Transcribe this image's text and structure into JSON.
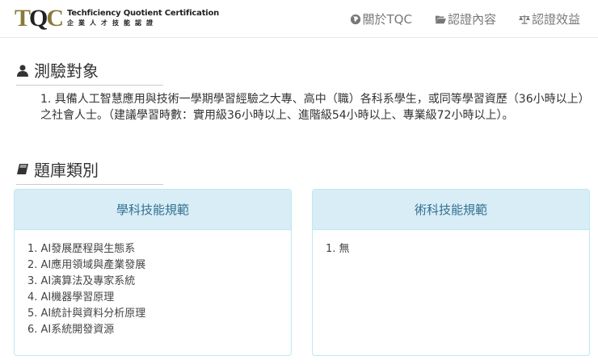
{
  "header": {
    "logo_mark": "TQC",
    "logo_en": "Techficiency Quotient Certification",
    "logo_zh": "企業人才技能認證",
    "nav": [
      {
        "label": "關於TQC",
        "icon": "globe-icon"
      },
      {
        "label": "認證內容",
        "icon": "folder-open-icon"
      },
      {
        "label": "認證效益",
        "icon": "balance-scale-icon"
      }
    ]
  },
  "section_target": {
    "title": "測驗對象",
    "items": [
      "1. 具備人工智慧應用與技術一學期學習經驗之大專、高中（職）各科系學生，或同等學習資歷（36小時以上）之社會人士。（建議學習時數：實用級36小時以上、進階級54小時以上、專業級72小時以上）。"
    ]
  },
  "section_bank": {
    "title": "題庫類別"
  },
  "panels": [
    {
      "title": "學科技能規範",
      "items": [
        "1. AI發展歷程與生態系",
        "2. AI應用領域與產業發展",
        "3. AI演算法及專家系統",
        "4. AI機器學習原理",
        "5. AI統計與資料分析原理",
        "6. AI系統開發資源"
      ]
    },
    {
      "title": "術科技能規範",
      "items": [
        "1. 無"
      ]
    }
  ]
}
